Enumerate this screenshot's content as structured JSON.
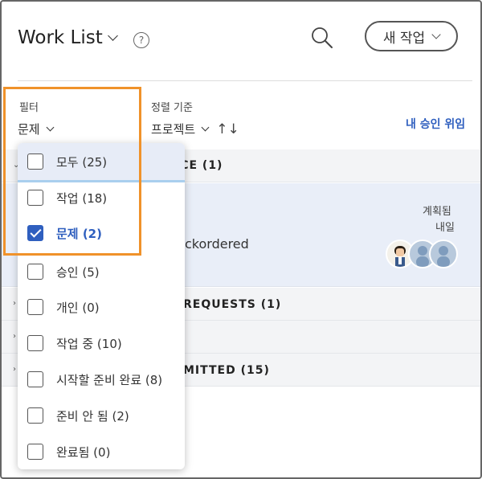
{
  "header": {
    "title": "Work List",
    "help_glyph": "?",
    "new_task_label": "새 작업"
  },
  "filter": {
    "label": "필터",
    "value": "문제",
    "options": [
      {
        "label": "모두 (25)",
        "checked": false
      },
      {
        "label": "작업 (18)",
        "checked": false
      },
      {
        "label": "문제 (2)",
        "checked": true
      },
      {
        "label": "승인 (5)",
        "checked": false
      },
      {
        "label": "개인 (0)",
        "checked": false
      },
      {
        "label": "작업 중 (10)",
        "checked": false
      },
      {
        "label": "시작할 준비 완료 (8)",
        "checked": false
      },
      {
        "label": "준비 안 됨 (2)",
        "checked": false
      },
      {
        "label": "완료됨 (0)",
        "checked": false
      }
    ]
  },
  "sort": {
    "label": "정렬 기준",
    "value": "프로젝트",
    "arrows_glyph": "↑↓"
  },
  "my_approvals_link": "내 승인 위임",
  "groups": [
    {
      "title": "ICE (1)"
    },
    {
      "title": "REQUESTS (1)"
    },
    {
      "title": "MITTED (15)"
    }
  ],
  "item": {
    "text": "ckordered",
    "status_line1": "계획됨",
    "status_line2": "내일"
  },
  "colors": {
    "accent": "#2f5fbf",
    "highlight_box": "#f0922a",
    "selected_row": "#e9eef8",
    "group_row": "#f3f4f6"
  },
  "icons": {
    "search": "search-icon",
    "help": "help-icon",
    "chevron": "chevron-down-icon"
  }
}
